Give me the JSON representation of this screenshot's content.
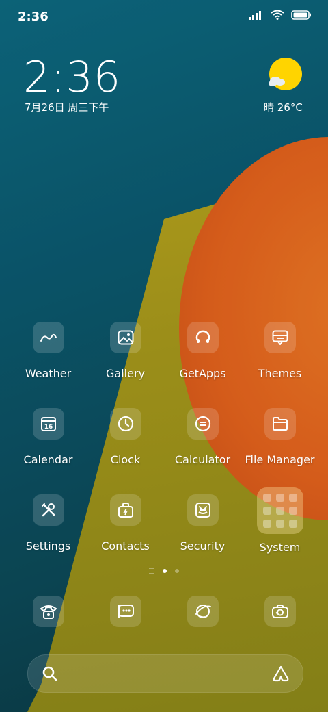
{
  "status_bar": {
    "time": "2:36",
    "icons": [
      "signal-icon",
      "wifi-icon",
      "battery-icon"
    ]
  },
  "clock_widget": {
    "time": "2:36",
    "date": "7月26日 周三下午"
  },
  "weather_widget": {
    "condition_temp": "晴 26°C",
    "icon": "sunny-partly-cloudy-icon"
  },
  "apps": [
    {
      "label": "Weather",
      "icon": "weather-icon"
    },
    {
      "label": "Gallery",
      "icon": "gallery-icon"
    },
    {
      "label": "GetApps",
      "icon": "getapps-icon"
    },
    {
      "label": "Themes",
      "icon": "themes-icon"
    },
    {
      "label": "Calendar",
      "icon": "calendar-icon",
      "badge": "16"
    },
    {
      "label": "Clock",
      "icon": "clock-icon"
    },
    {
      "label": "Calculator",
      "icon": "calculator-icon"
    },
    {
      "label": "File Manager",
      "icon": "folder-icon"
    },
    {
      "label": "Settings",
      "icon": "settings-icon"
    },
    {
      "label": "Contacts",
      "icon": "contacts-icon"
    },
    {
      "label": "Security",
      "icon": "security-icon"
    },
    {
      "label": "System",
      "icon": "system-folder-icon"
    }
  ],
  "page_indicator": {
    "pages": 2,
    "current": 1
  },
  "dock": [
    {
      "name": "phone",
      "icon": "phone-icon"
    },
    {
      "name": "messages",
      "icon": "messages-icon"
    },
    {
      "name": "browser",
      "icon": "browser-icon"
    },
    {
      "name": "camera",
      "icon": "camera-icon"
    }
  ],
  "search_bar": {
    "left_icon": "search-icon",
    "right_icon": "assistant-icon"
  }
}
